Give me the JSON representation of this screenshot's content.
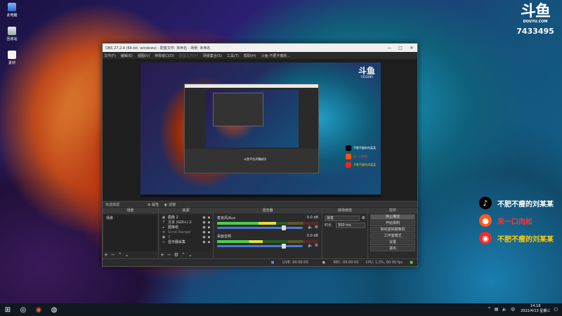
{
  "desktop": {
    "icons": [
      {
        "label": "此电脑",
        "icon": "computer-icon"
      },
      {
        "label": "回收站",
        "icon": "recycle-bin-icon"
      },
      {
        "label": "素材",
        "icon": "document-icon"
      }
    ]
  },
  "douyu": {
    "logo_text": "斗鱼",
    "url": "DOUYU.COM",
    "room_id": "7433495"
  },
  "social": [
    {
      "label": "不肥不瘦的刘某某",
      "icon": "tiktok-icon",
      "color": "#ffffff"
    },
    {
      "label": "来一口肉松",
      "icon": "kuaishou-icon",
      "color": "#ff3333"
    },
    {
      "label": "不肥不瘦的刘某某",
      "icon": "weibo-icon",
      "color": "#ffcc00"
    }
  ],
  "obs": {
    "title": "OBS 27.2.4 (64-bit, windows) - 配置文件: 未命名 - 场景: 未命名",
    "menu": [
      "文件(F)",
      "编辑(E)",
      "视图(V)",
      "停靠窗口(D)",
      "配置文件(P)",
      "场景集合(S)",
      "工具(T)",
      "帮助(H)",
      "斗鱼-不肥不瘦的..."
    ],
    "preview": {
      "nested_caption": "斗鱼平台开播成功",
      "social_labels": [
        "不肥不瘦的刘某某",
        "来一口肉松",
        "不肥不瘦的刘某某"
      ],
      "douyu_room": "7433495"
    },
    "context_bar": {
      "label": "未选择源",
      "buttons": [
        "属性",
        "滤镜"
      ]
    },
    "scenes": {
      "header": "场景",
      "items": [
        "场景"
      ]
    },
    "sources": {
      "header": "来源",
      "items": [
        {
          "label": "图像 2",
          "icon": "image-icon",
          "dim": false
        },
        {
          "label": "文本 (GDI+) 2",
          "icon": "text-icon",
          "dim": false
        },
        {
          "label": "图像组",
          "icon": "folder-icon",
          "dim": false
        },
        {
          "label": "Scroll Ranger",
          "icon": "scroll-icon",
          "dim": true
        },
        {
          "label": "2",
          "icon": "image-icon",
          "dim": true
        },
        {
          "label": "显示器采集",
          "icon": "monitor-icon",
          "dim": false
        }
      ]
    },
    "mixer": {
      "header": "混音器",
      "channels": [
        {
          "name": "麦克风/Aux",
          "db": "0.0 dB",
          "level": 0.58,
          "volume": 0.78
        },
        {
          "name": "桌面音频",
          "db": "0.0 dB",
          "level": 0.45,
          "volume": 0.78
        }
      ]
    },
    "transitions": {
      "header": "转场特效",
      "type_label": "",
      "type_value": "渐变",
      "duration_label": "时长",
      "duration_value": "300 ms"
    },
    "controls": {
      "header": "控件",
      "buttons": [
        "停止推流",
        "开始录制",
        "启动虚拟摄像机",
        "工作室模式",
        "设置",
        "退出"
      ]
    },
    "status": {
      "live": "LIVE: 00:00:00",
      "rec": "REC: 00:00:00",
      "cpu": "CPU: 1.5%, 60.00 fps"
    }
  },
  "taskbar": {
    "clock_time": "14:18",
    "clock_date": "2022/4/13 星期三"
  },
  "colors": {
    "obs_bg": "#2b2b2b",
    "meter_green": "#4ccf4c",
    "fader_blue": "#4a7ad8"
  }
}
